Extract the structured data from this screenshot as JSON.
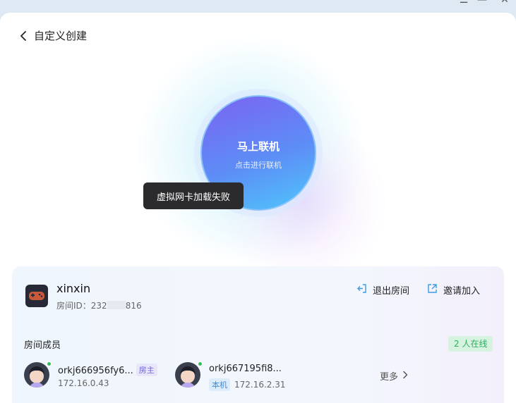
{
  "window": {
    "minimize_glyph": "☰",
    "maximize_glyph": "—",
    "close_glyph": "✕"
  },
  "header": {
    "back_label": "自定义创建"
  },
  "connect": {
    "title": "马上联机",
    "subtitle": "点击进行联机"
  },
  "toast": {
    "message": "虚拟网卡加载失败"
  },
  "room": {
    "name": "xinxin",
    "id_prefix": "房间ID：232",
    "id_suffix": "816",
    "exit_label": "退出房间",
    "invite_label": "邀请加入"
  },
  "members": {
    "title": "房间成员",
    "online_badge": "2 人在线",
    "more_label": "更多",
    "list": [
      {
        "name": "orkj666956fy6...",
        "tag": "房主",
        "ip": "172.16.0.43"
      },
      {
        "name": "orkj667195fi8...",
        "tag": "本机",
        "ip": "172.16.2.31"
      }
    ]
  },
  "colors": {
    "connect_gradient_start": "#7b63f2",
    "connect_gradient_end": "#4fc6fb",
    "online_green": "#2fae60",
    "host_tag": "#6f66d8",
    "local_tag": "#3b8de0"
  }
}
